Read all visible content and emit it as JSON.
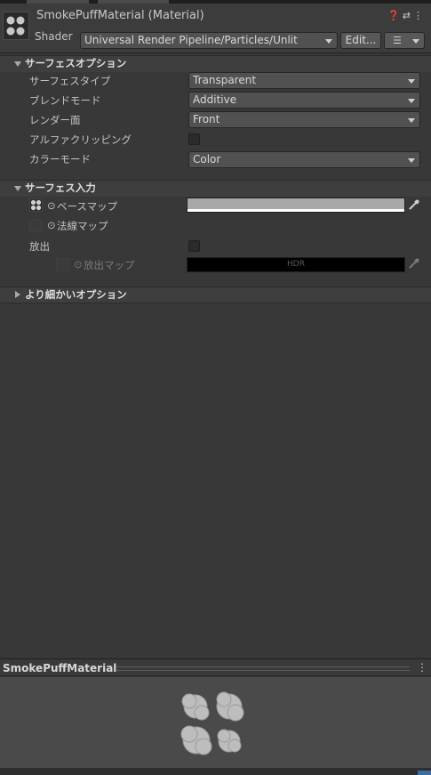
{
  "header": {
    "title": "SmokePuffMaterial (Material)",
    "shader_label": "Shader",
    "shader_value": "Universal Render Pipeline/Particles/Unlit",
    "edit_label": "Edit...",
    "menu_icon": "list-icon",
    "icons": [
      "help-icon",
      "presets-icon",
      "kebab-menu-icon"
    ]
  },
  "surface_options": {
    "title": "サーフェスオプション",
    "rows": [
      {
        "label": "サーフェスタイプ",
        "value": "Transparent"
      },
      {
        "label": "ブレンドモード",
        "value": "Additive"
      },
      {
        "label": "レンダー面",
        "value": "Front"
      },
      {
        "label": "アルファクリッピング",
        "checked": false
      },
      {
        "label": "カラーモード",
        "value": "Color"
      }
    ]
  },
  "surface_inputs": {
    "title": "サーフェス入力",
    "base_map": {
      "label": "ベースマップ"
    },
    "normal_map": {
      "label": "法線マップ"
    },
    "emission": {
      "label": "放出",
      "checked": false
    },
    "emission_map": {
      "label": "放出マップ",
      "hdr_label": "HDR"
    }
  },
  "advanced": {
    "title": "より細かいオプション"
  },
  "preview": {
    "title": "SmokePuffMaterial"
  },
  "colors": {
    "panel_bg": "#383838",
    "header_bg": "#3c3c3c",
    "preview_bg": "#4a4a4a",
    "accent": "#3a6ea5"
  }
}
